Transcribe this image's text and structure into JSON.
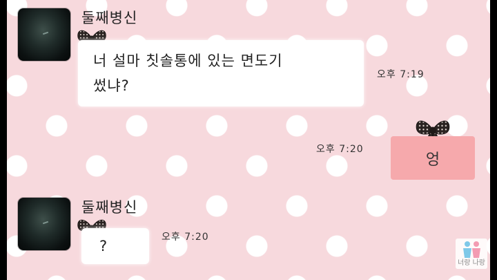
{
  "chat": {
    "messages": [
      {
        "sender": "둘째병신",
        "lines": [
          "너 설마 칫솔통에 있는 면도기",
          "썼냐?"
        ],
        "time": "오후 7:19"
      },
      {
        "sender": "me",
        "lines": [
          "엉"
        ],
        "time": "오후 7:20"
      },
      {
        "sender": "둘째병신",
        "lines": [
          "?"
        ],
        "time": "오후 7:20"
      }
    ],
    "watermark": "너랑 나랑"
  },
  "colors": {
    "background": "#f7d9dd",
    "my_bubble": "#f6a9ac",
    "their_bubble": "#ffffff"
  },
  "icons": {
    "bow": "polka-dot-bow-icon",
    "avatar": "dark-profile-photo",
    "watermark_logo": "two-people-logo-icon"
  }
}
